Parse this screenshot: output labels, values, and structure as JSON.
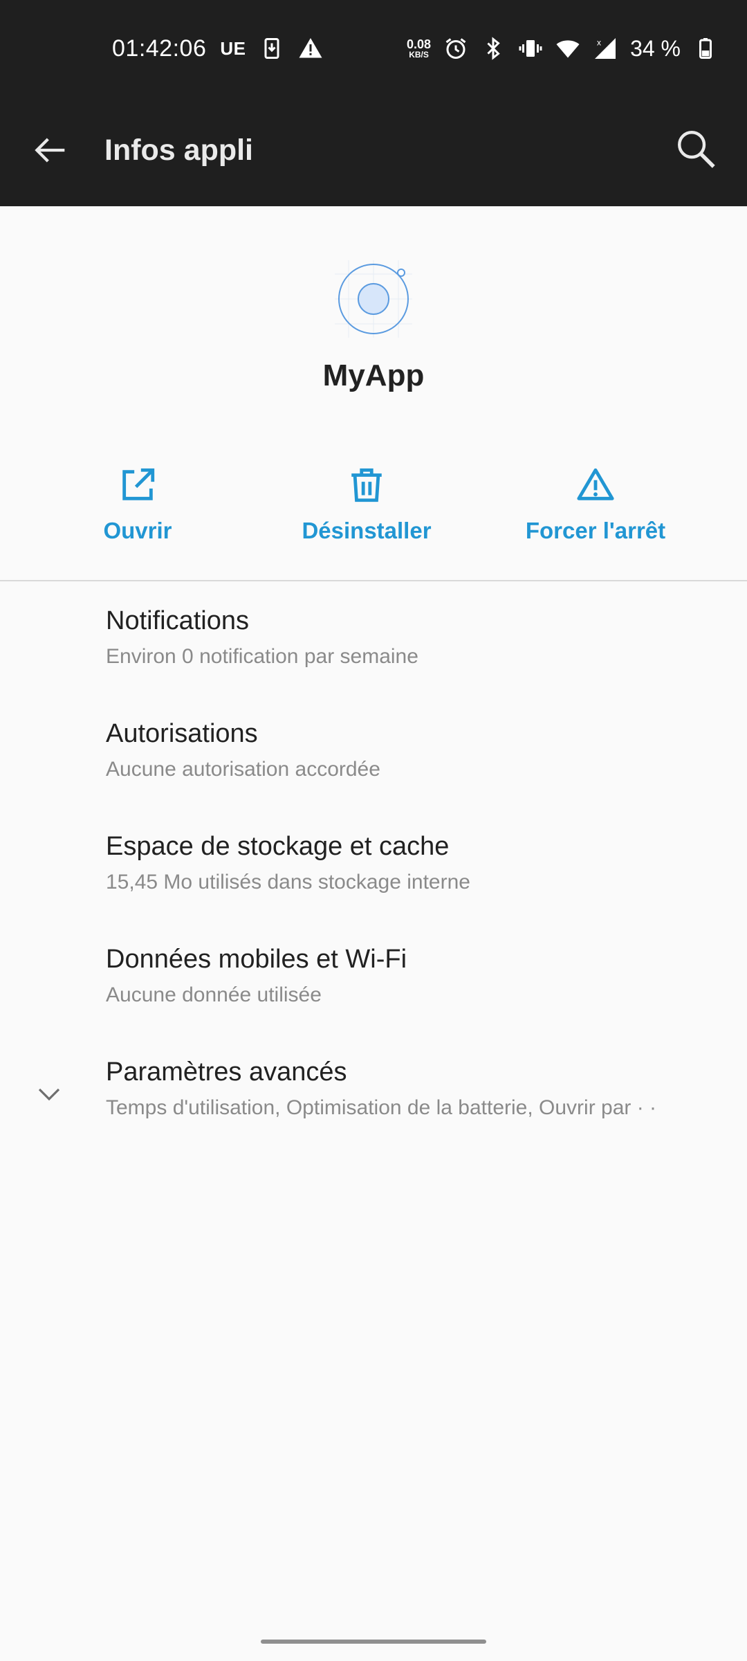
{
  "status_bar": {
    "time": "01:42:06",
    "carrier": "UE",
    "net_speed_value": "0.08",
    "net_speed_unit": "KB/S",
    "battery": "34 %",
    "icons": [
      "download-icon",
      "warning-icon",
      "alarm-icon",
      "bluetooth-icon",
      "vibrate-icon",
      "wifi-icon",
      "signal-icon",
      "battery-icon"
    ]
  },
  "appbar": {
    "title": "Infos appli"
  },
  "app": {
    "name": "MyApp"
  },
  "actions": [
    {
      "label": "Ouvrir",
      "icon": "open-external-icon"
    },
    {
      "label": "Désinstaller",
      "icon": "trash-icon"
    },
    {
      "label": "Forcer l'arrêt",
      "icon": "warning-triangle-icon"
    }
  ],
  "list": [
    {
      "title": "Notifications",
      "subtitle": "Environ 0 notification par semaine"
    },
    {
      "title": "Autorisations",
      "subtitle": "Aucune autorisation accordée"
    },
    {
      "title": "Espace de stockage et cache",
      "subtitle": "15,45 Mo utilisés dans stockage interne"
    },
    {
      "title": "Données mobiles et Wi-Fi",
      "subtitle": "Aucune donnée utilisée"
    },
    {
      "title": "Paramètres avancés",
      "subtitle": "Temps d'utilisation, Optimisation de la batterie, Ouvrir par · ·"
    }
  ],
  "colors": {
    "accent": "#2196d3",
    "bar_background": "#1f1f1f",
    "page_background": "#fafafa"
  }
}
